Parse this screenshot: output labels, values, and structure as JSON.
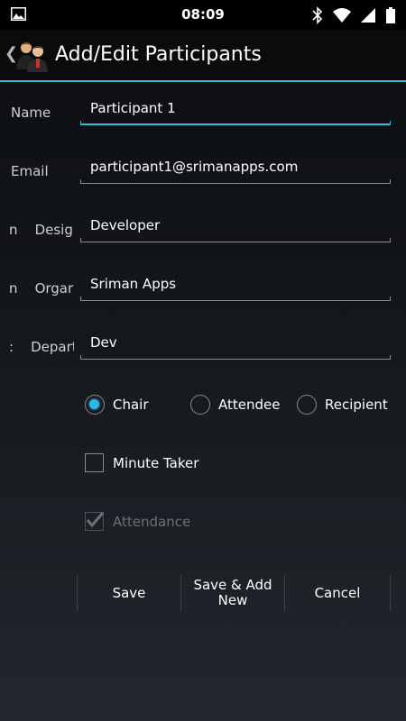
{
  "status_bar": {
    "time": "08:09",
    "left_icon": "image-icon",
    "right_icons": [
      "bluetooth-icon",
      "wifi-icon",
      "signal-icon",
      "battery-icon"
    ]
  },
  "action_bar": {
    "title": "Add/Edit Participants",
    "back_glyph": "❮",
    "icon": "participants-icon",
    "accent_color": "#33b5e5"
  },
  "form": {
    "name": {
      "label": "Name",
      "value": "Participant 1"
    },
    "email": {
      "label": "Email",
      "value": "participant1@srimanapps.com"
    },
    "designation": {
      "label_visible": "n    Design",
      "value": "Developer"
    },
    "organization": {
      "label_visible": "n    Orgar",
      "value": "Sriman Apps"
    },
    "department": {
      "label_visible": ":    Depart",
      "value": "Dev"
    }
  },
  "role": {
    "options": [
      "Chair",
      "Attendee",
      "Recipient"
    ],
    "selected": "Chair"
  },
  "checkboxes": {
    "minute_taker": {
      "label": "Minute Taker",
      "checked": false
    },
    "attendance": {
      "label": "Attendance",
      "checked": true,
      "enabled": false
    }
  },
  "buttons": {
    "save": "Save",
    "save_add_new_line1": "Save & Add",
    "save_add_new_line2": "New",
    "cancel": "Cancel"
  }
}
